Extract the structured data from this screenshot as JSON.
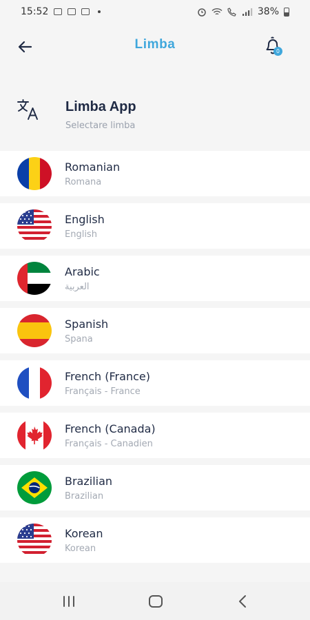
{
  "status_bar": {
    "time": "15:52",
    "battery": "38%"
  },
  "header": {
    "title": "Limba",
    "notification_count": "0"
  },
  "section": {
    "title": "Limba App",
    "subtitle": "Selectare limba"
  },
  "languages": [
    {
      "name": "Romanian",
      "native": "Romana",
      "flag": "romania-flag-icon"
    },
    {
      "name": "English",
      "native": "English",
      "flag": "usa-flag-icon"
    },
    {
      "name": "Arabic",
      "native": "العربية",
      "flag": "uae-flag-icon"
    },
    {
      "name": "Spanish",
      "native": "Spana",
      "flag": "spain-flag-icon"
    },
    {
      "name": "French (France)",
      "native": "Français - France",
      "flag": "france-flag-icon"
    },
    {
      "name": "French (Canada)",
      "native": "Français - Canadien",
      "flag": "canada-flag-icon"
    },
    {
      "name": "Brazilian",
      "native": "Brazilian",
      "flag": "brazil-flag-icon"
    },
    {
      "name": "Korean",
      "native": "Korean",
      "flag": "usa-flag-icon"
    }
  ],
  "colors": {
    "accent": "#3fa7dc",
    "text_primary": "#1f2a44",
    "text_secondary": "#a3a9b3"
  }
}
